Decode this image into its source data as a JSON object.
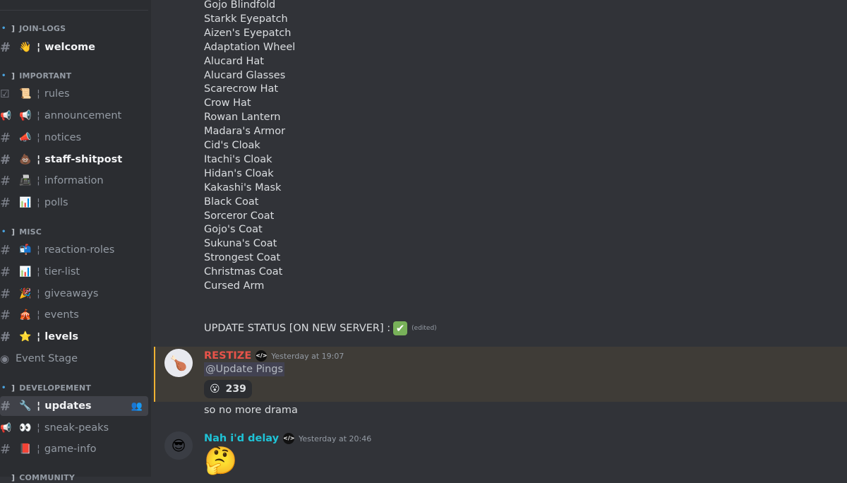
{
  "sidebar": {
    "categories": [
      {
        "label": "JOIN-LOGS"
      },
      {
        "label": "IMPORTANT"
      },
      {
        "label": "MISC"
      },
      {
        "label": "DEVELOPEMENT"
      },
      {
        "label": "COMMUNITY"
      }
    ],
    "channels": [
      {
        "icon": "#",
        "emoji": "👋",
        "label": "welcome"
      },
      {
        "icon": "☑",
        "emoji": "📜",
        "label": "rules"
      },
      {
        "icon": "📢",
        "emoji": "📢",
        "label": "announcement"
      },
      {
        "icon": "#",
        "emoji": "📣",
        "label": "notices"
      },
      {
        "icon": "#",
        "emoji": "💩",
        "label": "staff-shitpost"
      },
      {
        "icon": "#",
        "emoji": "📠",
        "label": "information"
      },
      {
        "icon": "#",
        "emoji": "📊",
        "label": "polls"
      },
      {
        "icon": "#",
        "emoji": "📬",
        "label": "reaction-roles"
      },
      {
        "icon": "#",
        "emoji": "📊",
        "label": "tier-list"
      },
      {
        "icon": "#",
        "emoji": "🎉",
        "label": "giveaways"
      },
      {
        "icon": "#",
        "emoji": "🎪",
        "label": "events"
      },
      {
        "icon": "#",
        "emoji": "⭐",
        "label": "levels"
      },
      {
        "icon": "#",
        "emoji": "🔧",
        "label": "updates"
      },
      {
        "icon": "📢",
        "emoji": "👀",
        "label": "sneak-peaks"
      },
      {
        "icon": "#",
        "emoji": "📕",
        "label": "game-info"
      }
    ],
    "stage": {
      "label": "Event Stage"
    },
    "separator": "¦"
  },
  "messages": {
    "item_list": [
      "Gojo Blindfold",
      "Starkk Eyepatch",
      "Aizen's Eyepatch",
      "Adaptation Wheel",
      "Alucard Hat",
      "Alucard Glasses",
      "Scarecrow Hat",
      "Crow Hat",
      "Rowan Lantern",
      "Madara's Armor",
      "Cid's Cloak",
      "Itachi's Cloak",
      "Hidan's Cloak",
      "Kakashi's Mask",
      "Black Coat",
      "Sorceror Coat",
      "Gojo's Coat",
      "Sukuna's Coat",
      "Strongest Coat",
      "Christmas Coat",
      "Cursed Arm"
    ],
    "status_text": "UPDATE STATUS [ON NEW SERVER] :",
    "status_check": "✔",
    "edited": "(edited)",
    "msg1": {
      "author": "RESTIZE",
      "author_color": "#e8534a",
      "badge": "</>",
      "timestamp": "Yesterday at 19:07",
      "mention": "@Update Pings",
      "reaction_emoji": "😮",
      "reaction_count": "239",
      "avatar_emoji": "🍗"
    },
    "msg1_followup": "so no more drama",
    "msg2": {
      "author": "Nah i'd delay",
      "author_color": "#1fc3d6",
      "badge": "</>",
      "timestamp": "Yesterday at 20:46",
      "avatar_emoji": "😎",
      "emoji": "🤔"
    }
  }
}
